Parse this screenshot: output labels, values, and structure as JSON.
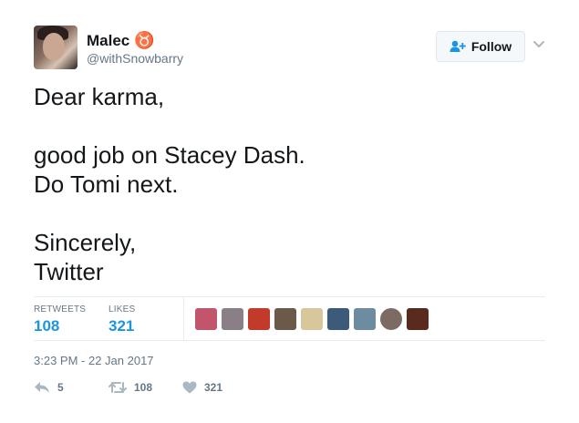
{
  "user": {
    "display_name": "Malec",
    "name_glyph": "♉",
    "handle": "@withSnowbarry"
  },
  "follow_button": {
    "label": "Follow"
  },
  "tweet": {
    "text": "Dear karma,\n\ngood job on Stacey Dash.\nDo Tomi next.\n\nSincerely,\nTwitter",
    "timestamp": "3:23 PM - 22 Jan 2017"
  },
  "stats": {
    "retweets_label": "RETWEETS",
    "retweets_count": "108",
    "likes_label": "LIKES",
    "likes_count": "321"
  },
  "likers": [
    {
      "color": "#c2556b"
    },
    {
      "color": "#8a7f86"
    },
    {
      "color": "#c23a2a"
    },
    {
      "color": "#6b5a4a"
    },
    {
      "color": "#d8c79a"
    },
    {
      "color": "#3c5a7a"
    },
    {
      "color": "#6d8ca0"
    },
    {
      "color": "#7b6b63"
    },
    {
      "color": "#5a2a1e"
    }
  ],
  "actions": {
    "reply_count": "5",
    "retweet_count": "108",
    "like_count": "321"
  },
  "colors": {
    "accent": "#1b95e0",
    "muted": "#657786",
    "border": "#e6ecf0"
  }
}
